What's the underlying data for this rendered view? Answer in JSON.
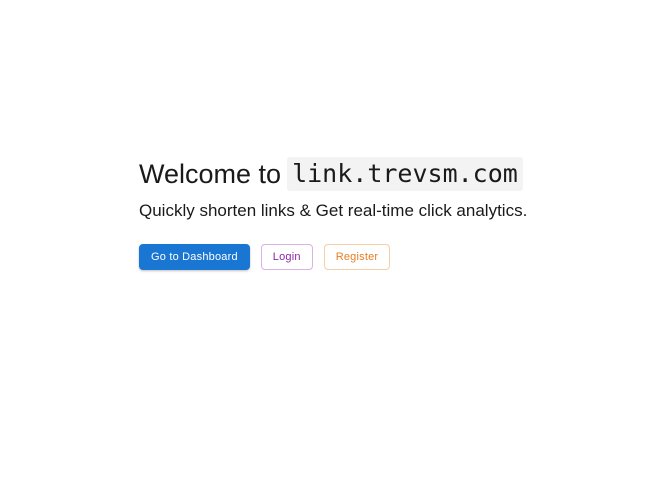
{
  "hero": {
    "welcome_prefix": "Welcome to",
    "domain": "link.trevsm.com",
    "tagline": "Quickly shorten links & Get real-time click analytics."
  },
  "actions": {
    "dashboard_label": "Go to Dashboard",
    "login_label": "Login",
    "register_label": "Register"
  },
  "colors": {
    "primary": "#1976d2",
    "login": "#8e24aa",
    "register": "#e67e22"
  }
}
